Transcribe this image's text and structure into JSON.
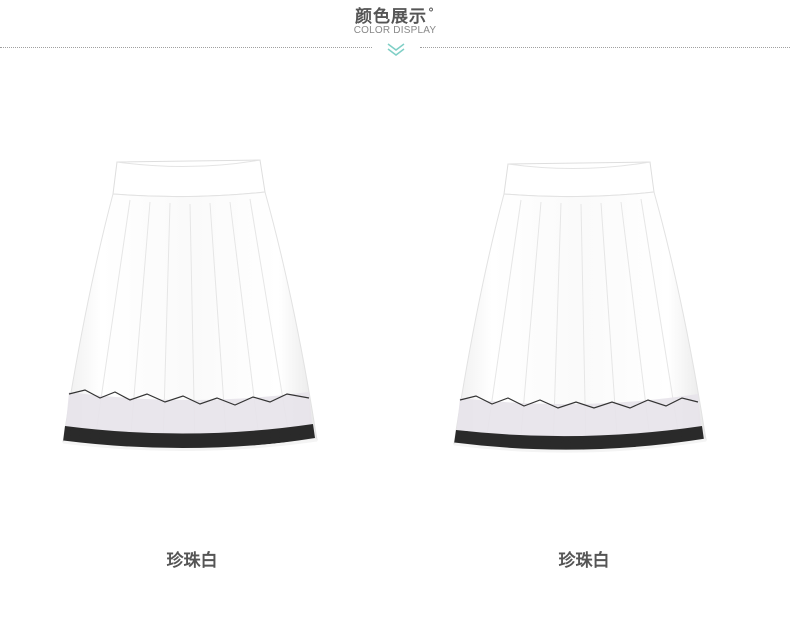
{
  "section": {
    "title": "颜色展示",
    "title_mark": "°",
    "subtitle": "COLOR DISPLAY"
  },
  "products": [
    {
      "color_name": "珍珠白"
    },
    {
      "color_name": "珍珠白"
    }
  ],
  "colors": {
    "text": "#555555",
    "accent": "#7fcfc6",
    "skirt": "#ffffff",
    "pattern": "#222222"
  },
  "icons": {
    "divider": "chevron-down-icon"
  }
}
